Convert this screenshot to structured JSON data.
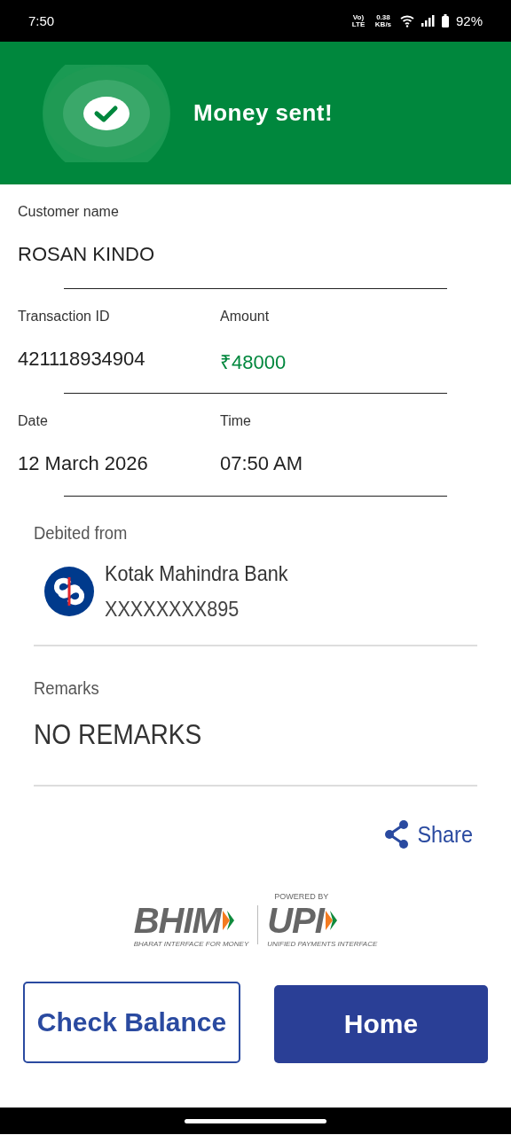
{
  "status_bar": {
    "time": "7:50",
    "volte": "Vo) LTE",
    "speed": "0.38 KB/s",
    "battery": "92%"
  },
  "header": {
    "title": "Money sent!"
  },
  "details": [
    {
      "label": "Customer name",
      "value": "ROSAN KINDO",
      "kind": "plain"
    },
    {
      "label": "Transaction ID",
      "value": "421118934904",
      "kind": "plain"
    },
    {
      "label": "Amount",
      "value": "₹48000",
      "kind": "amount"
    },
    {
      "label": "Date",
      "value": "12 March 2026",
      "kind": "plain"
    },
    {
      "label": "Time",
      "value": "07:50 AM",
      "kind": "plain"
    }
  ],
  "debited": {
    "label": "Debited from",
    "bank": "Kotak Mahindra Bank",
    "account": "XXXXXXXX895"
  },
  "remarks": {
    "label": "Remarks",
    "value": "NO REMARKS"
  },
  "share": {
    "label": "Share"
  },
  "branding": {
    "bhim": "BHIM",
    "bhim_tagline": "BHARAT INTERFACE FOR MONEY",
    "powered_by": "POWERED BY",
    "upi": "UPI",
    "upi_tagline": "UNIFIED PAYMENTS INTERFACE"
  },
  "buttons": [
    {
      "label": "Check Balance",
      "kind": "outline"
    },
    {
      "label": "Home",
      "kind": "filled"
    }
  ]
}
